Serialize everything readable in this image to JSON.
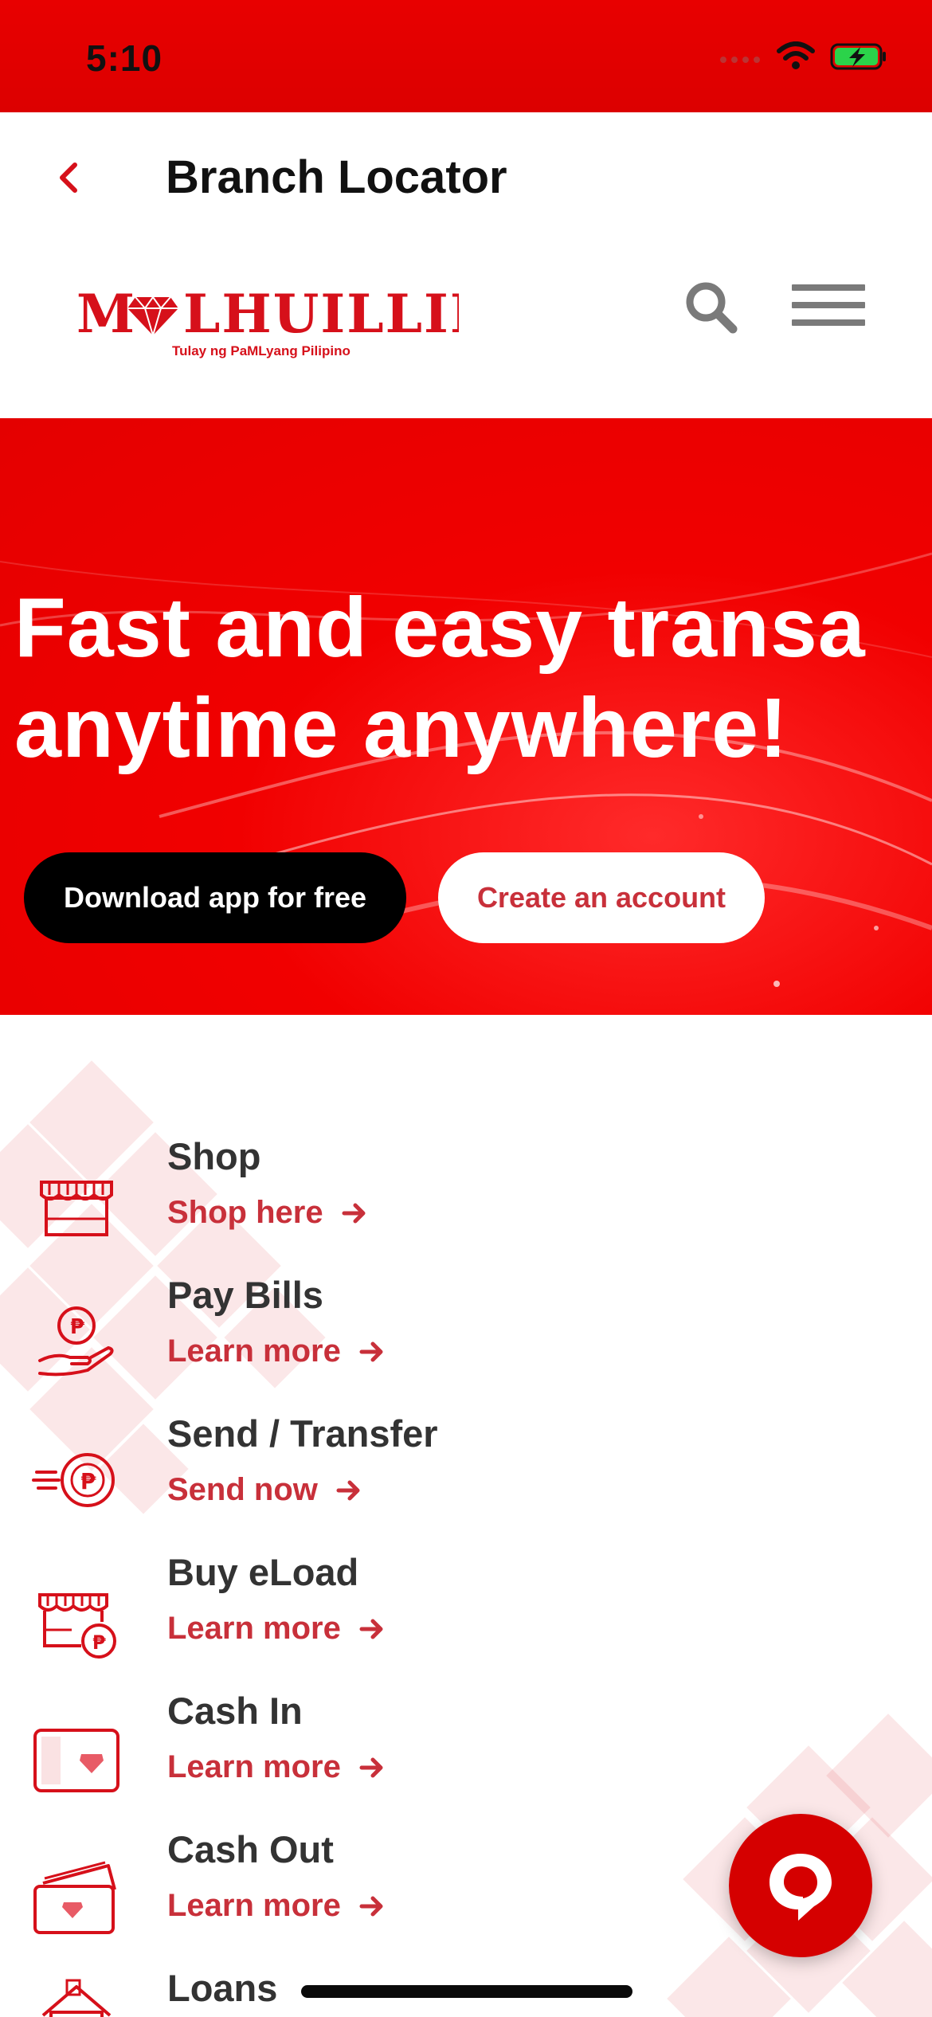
{
  "status_bar": {
    "time": "5:10",
    "icons": [
      "cellular-signal-icon",
      "wifi-icon",
      "battery-charging-icon"
    ]
  },
  "nav": {
    "back_icon": "chevron-left-icon",
    "title": "Branch Locator"
  },
  "header": {
    "logo_text": "MLHUILLIER",
    "logo_tagline": "Tulay ng PaMLyang Pilipino",
    "search_icon": "search-icon",
    "menu_icon": "hamburger-menu-icon"
  },
  "hero": {
    "headline_line1": "Fast and easy transa",
    "headline_line2": "anytime anywhere!",
    "download_button": "Download app for free",
    "create_button": "Create an account"
  },
  "services": [
    {
      "title": "Shop",
      "link": "Shop here",
      "icon": "storefront-icon"
    },
    {
      "title": "Pay Bills",
      "link": "Learn more",
      "icon": "hand-coin-icon"
    },
    {
      "title": "Send / Transfer",
      "link": "Send now",
      "icon": "fast-coin-icon"
    },
    {
      "title": "Buy eLoad",
      "link": "Learn more",
      "icon": "store-coin-icon"
    },
    {
      "title": "Cash In",
      "link": "Learn more",
      "icon": "wallet-icon"
    },
    {
      "title": "Cash Out",
      "link": "Learn more",
      "icon": "cards-icon"
    },
    {
      "title": "Loans",
      "link": "",
      "icon": "house-icon"
    }
  ],
  "chat": {
    "icon": "chat-bubble-icon"
  },
  "colors": {
    "brand_red": "#e00000",
    "link_red": "#c8303a",
    "text_dark": "#333333"
  }
}
